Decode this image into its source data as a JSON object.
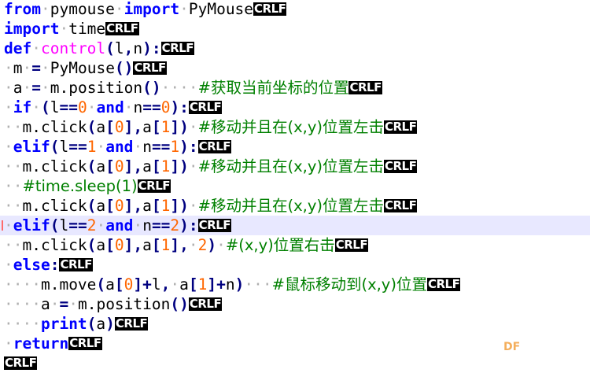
{
  "editor": {
    "lines": [
      {
        "tokens": [
          {
            "t": "kw",
            "v": "from"
          },
          {
            "t": "ws",
            "v": "·"
          },
          {
            "t": "id",
            "v": "pymouse"
          },
          {
            "t": "ws",
            "v": "·"
          },
          {
            "t": "kw",
            "v": "import"
          },
          {
            "t": "ws",
            "v": "·"
          },
          {
            "t": "id",
            "v": "PyMouse"
          },
          {
            "t": "crlf",
            "v": "CRLF"
          }
        ]
      },
      {
        "tokens": [
          {
            "t": "kw",
            "v": "import"
          },
          {
            "t": "ws",
            "v": "·"
          },
          {
            "t": "id",
            "v": "time"
          },
          {
            "t": "crlf",
            "v": "CRLF"
          }
        ]
      },
      {
        "tokens": [
          {
            "t": "kw",
            "v": "def"
          },
          {
            "t": "ws",
            "v": "·"
          },
          {
            "t": "fn",
            "v": "control"
          },
          {
            "t": "op",
            "v": "("
          },
          {
            "t": "id",
            "v": "l"
          },
          {
            "t": "op",
            "v": ","
          },
          {
            "t": "id",
            "v": "n"
          },
          {
            "t": "op",
            "v": "):"
          },
          {
            "t": "crlf",
            "v": "CRLF"
          }
        ]
      },
      {
        "tokens": [
          {
            "t": "ws",
            "v": "·"
          },
          {
            "t": "id",
            "v": "m"
          },
          {
            "t": "ws",
            "v": "·"
          },
          {
            "t": "op",
            "v": "="
          },
          {
            "t": "ws",
            "v": "·"
          },
          {
            "t": "id",
            "v": "PyMouse"
          },
          {
            "t": "op",
            "v": "()"
          },
          {
            "t": "crlf",
            "v": "CRLF"
          }
        ]
      },
      {
        "tokens": [
          {
            "t": "ws",
            "v": "·"
          },
          {
            "t": "id",
            "v": "a"
          },
          {
            "t": "ws",
            "v": "·"
          },
          {
            "t": "op",
            "v": "="
          },
          {
            "t": "ws",
            "v": "·"
          },
          {
            "t": "id",
            "v": "m.position"
          },
          {
            "t": "op",
            "v": "()"
          },
          {
            "t": "ws",
            "v": "····"
          },
          {
            "t": "cm",
            "v": "#获取当前坐标的位置"
          },
          {
            "t": "crlf",
            "v": "CRLF"
          }
        ]
      },
      {
        "tokens": [
          {
            "t": "ws",
            "v": "·"
          },
          {
            "t": "kw",
            "v": "if"
          },
          {
            "t": "ws",
            "v": "·"
          },
          {
            "t": "op",
            "v": "("
          },
          {
            "t": "id",
            "v": "l"
          },
          {
            "t": "op",
            "v": "=="
          },
          {
            "t": "num",
            "v": "0"
          },
          {
            "t": "ws",
            "v": "·"
          },
          {
            "t": "kw",
            "v": "and"
          },
          {
            "t": "ws",
            "v": "·"
          },
          {
            "t": "id",
            "v": "n"
          },
          {
            "t": "op",
            "v": "=="
          },
          {
            "t": "num",
            "v": "0"
          },
          {
            "t": "op",
            "v": "):"
          },
          {
            "t": "crlf",
            "v": "CRLF"
          }
        ]
      },
      {
        "tokens": [
          {
            "t": "ws",
            "v": "··"
          },
          {
            "t": "id",
            "v": "m.click"
          },
          {
            "t": "op",
            "v": "("
          },
          {
            "t": "id",
            "v": "a"
          },
          {
            "t": "op",
            "v": "["
          },
          {
            "t": "num",
            "v": "0"
          },
          {
            "t": "op",
            "v": "],"
          },
          {
            "t": "id",
            "v": "a"
          },
          {
            "t": "op",
            "v": "["
          },
          {
            "t": "num",
            "v": "1"
          },
          {
            "t": "op",
            "v": "])"
          },
          {
            "t": "ws",
            "v": "·"
          },
          {
            "t": "cm",
            "v": "#移动并且在(x,y)位置左击"
          },
          {
            "t": "crlf",
            "v": "CRLF"
          }
        ]
      },
      {
        "tokens": [
          {
            "t": "ws",
            "v": "·"
          },
          {
            "t": "kw",
            "v": "elif"
          },
          {
            "t": "op",
            "v": "("
          },
          {
            "t": "id",
            "v": "l"
          },
          {
            "t": "op",
            "v": "=="
          },
          {
            "t": "num",
            "v": "1"
          },
          {
            "t": "ws",
            "v": "·"
          },
          {
            "t": "kw",
            "v": "and"
          },
          {
            "t": "ws",
            "v": "·"
          },
          {
            "t": "id",
            "v": "n"
          },
          {
            "t": "op",
            "v": "=="
          },
          {
            "t": "num",
            "v": "1"
          },
          {
            "t": "op",
            "v": "):"
          },
          {
            "t": "crlf",
            "v": "CRLF"
          }
        ]
      },
      {
        "tokens": [
          {
            "t": "ws",
            "v": "··"
          },
          {
            "t": "id",
            "v": "m.click"
          },
          {
            "t": "op",
            "v": "("
          },
          {
            "t": "id",
            "v": "a"
          },
          {
            "t": "op",
            "v": "["
          },
          {
            "t": "num",
            "v": "0"
          },
          {
            "t": "op",
            "v": "],"
          },
          {
            "t": "id",
            "v": "a"
          },
          {
            "t": "op",
            "v": "["
          },
          {
            "t": "num",
            "v": "1"
          },
          {
            "t": "op",
            "v": "])"
          },
          {
            "t": "ws",
            "v": "·"
          },
          {
            "t": "cm",
            "v": "#移动并且在(x,y)位置左击"
          },
          {
            "t": "crlf",
            "v": "CRLF"
          }
        ]
      },
      {
        "tokens": [
          {
            "t": "ws",
            "v": "··"
          },
          {
            "t": "cm",
            "v": "#time.sleep(1)"
          },
          {
            "t": "crlf",
            "v": "CRLF"
          }
        ]
      },
      {
        "tokens": [
          {
            "t": "ws",
            "v": "··"
          },
          {
            "t": "id",
            "v": "m.click"
          },
          {
            "t": "op",
            "v": "("
          },
          {
            "t": "id",
            "v": "a"
          },
          {
            "t": "op",
            "v": "["
          },
          {
            "t": "num",
            "v": "0"
          },
          {
            "t": "op",
            "v": "],"
          },
          {
            "t": "id",
            "v": "a"
          },
          {
            "t": "op",
            "v": "["
          },
          {
            "t": "num",
            "v": "1"
          },
          {
            "t": "op",
            "v": "])"
          },
          {
            "t": "ws",
            "v": "·"
          },
          {
            "t": "cm",
            "v": "#移动并且在(x,y)位置左击"
          },
          {
            "t": "crlf",
            "v": "CRLF"
          }
        ]
      },
      {
        "active": true,
        "marker": true,
        "tokens": [
          {
            "t": "ws",
            "v": "·"
          },
          {
            "t": "kw",
            "v": "elif"
          },
          {
            "t": "op",
            "v": "("
          },
          {
            "t": "id",
            "v": "l"
          },
          {
            "t": "op",
            "v": "=="
          },
          {
            "t": "num",
            "v": "2"
          },
          {
            "t": "ws",
            "v": "·"
          },
          {
            "t": "kw",
            "v": "and"
          },
          {
            "t": "ws",
            "v": "·"
          },
          {
            "t": "id",
            "v": "n"
          },
          {
            "t": "op",
            "v": "=="
          },
          {
            "t": "num",
            "v": "2"
          },
          {
            "t": "op",
            "v": "):"
          },
          {
            "t": "caret",
            "v": ""
          },
          {
            "t": "crlf",
            "v": "CRLF"
          }
        ]
      },
      {
        "tokens": [
          {
            "t": "ws",
            "v": "··"
          },
          {
            "t": "id",
            "v": "m.click"
          },
          {
            "t": "op",
            "v": "("
          },
          {
            "t": "id",
            "v": "a"
          },
          {
            "t": "op",
            "v": "["
          },
          {
            "t": "num",
            "v": "0"
          },
          {
            "t": "op",
            "v": "],"
          },
          {
            "t": "id",
            "v": "a"
          },
          {
            "t": "op",
            "v": "["
          },
          {
            "t": "num",
            "v": "1"
          },
          {
            "t": "op",
            "v": "],"
          },
          {
            "t": "ws",
            "v": "·"
          },
          {
            "t": "num",
            "v": "2"
          },
          {
            "t": "op",
            "v": ")"
          },
          {
            "t": "ws",
            "v": "·"
          },
          {
            "t": "cm",
            "v": "#(x,y)位置右击"
          },
          {
            "t": "crlf",
            "v": "CRLF"
          }
        ]
      },
      {
        "tokens": [
          {
            "t": "ws",
            "v": "·"
          },
          {
            "t": "kw",
            "v": "else"
          },
          {
            "t": "op",
            "v": ":"
          },
          {
            "t": "crlf",
            "v": "CRLF"
          }
        ]
      },
      {
        "tokens": [
          {
            "t": "ws",
            "v": "····"
          },
          {
            "t": "id",
            "v": "m.move"
          },
          {
            "t": "op",
            "v": "("
          },
          {
            "t": "id",
            "v": "a"
          },
          {
            "t": "op",
            "v": "["
          },
          {
            "t": "num",
            "v": "0"
          },
          {
            "t": "op",
            "v": "]+"
          },
          {
            "t": "id",
            "v": "l"
          },
          {
            "t": "op",
            "v": ","
          },
          {
            "t": "ws",
            "v": "·"
          },
          {
            "t": "id",
            "v": "a"
          },
          {
            "t": "op",
            "v": "["
          },
          {
            "t": "num",
            "v": "1"
          },
          {
            "t": "op",
            "v": "]+"
          },
          {
            "t": "id",
            "v": "n"
          },
          {
            "t": "op",
            "v": ")"
          },
          {
            "t": "ws",
            "v": "···"
          },
          {
            "t": "cm",
            "v": "#鼠标移动到(x,y)位置"
          },
          {
            "t": "crlf",
            "v": "CRLF"
          }
        ]
      },
      {
        "tokens": [
          {
            "t": "ws",
            "v": "····"
          },
          {
            "t": "id",
            "v": "a"
          },
          {
            "t": "ws",
            "v": "·"
          },
          {
            "t": "op",
            "v": "="
          },
          {
            "t": "ws",
            "v": "·"
          },
          {
            "t": "id",
            "v": "m.position"
          },
          {
            "t": "op",
            "v": "()"
          },
          {
            "t": "crlf",
            "v": "CRLF"
          }
        ]
      },
      {
        "tokens": [
          {
            "t": "ws",
            "v": "····"
          },
          {
            "t": "kw",
            "v": "print"
          },
          {
            "t": "op",
            "v": "("
          },
          {
            "t": "id",
            "v": "a"
          },
          {
            "t": "op",
            "v": ")"
          },
          {
            "t": "crlf",
            "v": "CRLF"
          }
        ]
      },
      {
        "tokens": [
          {
            "t": "ws",
            "v": "·"
          },
          {
            "t": "kw",
            "v": "return"
          },
          {
            "t": "crlf",
            "v": "CRLF"
          }
        ]
      },
      {
        "tokens": [
          {
            "t": "crlf",
            "v": "CRLF"
          }
        ]
      }
    ]
  },
  "watermark": {
    "text": "DF"
  }
}
